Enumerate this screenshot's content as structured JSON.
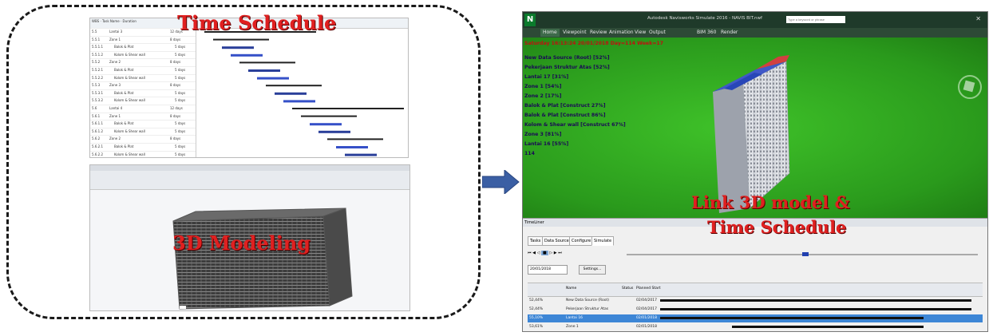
{
  "captions": {
    "time_schedule": "Time Schedule",
    "modeling": "3D Modeling",
    "link_line1": "Link 3D model &",
    "link_line2": "Time Schedule"
  },
  "schedule": {
    "columns": [
      "WBS",
      "Task Name",
      "Duration"
    ],
    "rows": [
      {
        "wbs": "5.5",
        "name": "Lantai 3",
        "dur": "12 days"
      },
      {
        "wbs": "5.5.1",
        "name": "Zone 1",
        "dur": "8 days"
      },
      {
        "wbs": "5.5.1.1",
        "name": "Balok & Plat",
        "dur": "5 days"
      },
      {
        "wbs": "5.5.1.2",
        "name": "Kolom & Shear wall",
        "dur": "5 days"
      },
      {
        "wbs": "5.5.2",
        "name": "Zone 2",
        "dur": "8 days"
      },
      {
        "wbs": "5.5.2.1",
        "name": "Balok & Plat",
        "dur": "5 days"
      },
      {
        "wbs": "5.5.2.2",
        "name": "Kolom & Shear wall",
        "dur": "5 days"
      },
      {
        "wbs": "5.5.3",
        "name": "Zone 3",
        "dur": "8 days"
      },
      {
        "wbs": "5.5.3.1",
        "name": "Balok & Plat",
        "dur": "5 days"
      },
      {
        "wbs": "5.5.3.2",
        "name": "Kolom & Shear wall",
        "dur": "5 days"
      },
      {
        "wbs": "5.6",
        "name": "Lantai 4",
        "dur": "12 days"
      },
      {
        "wbs": "5.6.1",
        "name": "Zone 1",
        "dur": "8 days"
      },
      {
        "wbs": "5.6.1.1",
        "name": "Balok & Plat",
        "dur": "5 days"
      },
      {
        "wbs": "5.6.1.2",
        "name": "Kolom & Shear wall",
        "dur": "5 days"
      },
      {
        "wbs": "5.6.2",
        "name": "Zone 2",
        "dur": "8 days"
      },
      {
        "wbs": "5.6.2.1",
        "name": "Balok & Plat",
        "dur": "5 days"
      },
      {
        "wbs": "5.6.2.2",
        "name": "Kolom & Shear wall",
        "dur": "5 days"
      },
      {
        "wbs": "5.6.3",
        "name": "Zone 3",
        "dur": "8 days"
      },
      {
        "wbs": "5.6.3.1",
        "name": "Balok & Plat",
        "dur": "5 days"
      },
      {
        "wbs": "5.6.3.2",
        "name": "Kolom & Shear wall",
        "dur": "5 days"
      }
    ]
  },
  "navisworks": {
    "title": "Autodesk Navisworks Simulate 2016 - NAVIS BIT.nwf",
    "search_placeholder": "Type a keyword or phrase",
    "menu": [
      "Home",
      "Viewpoint",
      "Review",
      "Animation",
      "View",
      "Output",
      "BIM 360",
      "Render"
    ],
    "overlay_date": "Saturday 16:13:24 20/01/2018 Day=114 Week=17",
    "overlay_tasks": [
      "New Data Source (Root) [52%]",
      "Pekerjaan Struktur Atas [52%]",
      "Lantai 17 [31%]",
      "Zone 1 [54%]",
      "Zone 2 [17%]",
      "Balok & Plat [Construct 27%]",
      "Balok & Plat [Construct 86%]",
      "Kolom & Shear wall [Construct 67%]",
      "Zone 3 [81%]",
      "Lantai 16 [55%]",
      "114"
    ],
    "timeliner": {
      "label": "TimeLiner",
      "tabs": [
        "Tasks",
        "Data Sources",
        "Configure",
        "Simulate"
      ],
      "date_field": "20/01/2018",
      "settings": "Settings...",
      "columns": [
        "Name",
        "Status",
        "Planned Start"
      ],
      "rows": [
        {
          "pct": "52,44%",
          "name": "New Data Source (Root)",
          "start": "02/04/2017"
        },
        {
          "pct": "52,44%",
          "name": "Pekerjaan Struktur Atas",
          "start": "02/04/2017"
        },
        {
          "pct": "55,10%",
          "name": "Lantai 16",
          "start": "02/01/2018"
        },
        {
          "pct": "53,61%",
          "name": "Zone 1",
          "start": "02/01/2018"
        }
      ]
    }
  }
}
